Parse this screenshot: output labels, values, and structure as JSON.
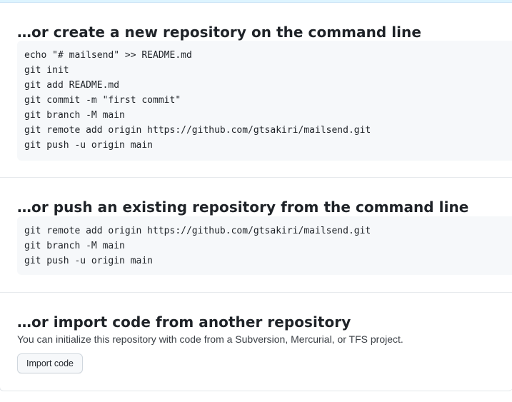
{
  "sections": {
    "new_repo": {
      "title": "…or create a new repository on the command line",
      "code_lines": [
        "echo \"# mailsend\" >> README.md",
        "git init",
        "git add README.md",
        "git commit -m \"first commit\"",
        "git branch -M main",
        "git remote add origin https://github.com/gtsakiri/mailsend.git",
        "git push -u origin main"
      ]
    },
    "push_existing": {
      "title": "…or push an existing repository from the command line",
      "code_lines": [
        "git remote add origin https://github.com/gtsakiri/mailsend.git",
        "git branch -M main",
        "git push -u origin main"
      ]
    },
    "import_code": {
      "title": "…or import code from another repository",
      "description": "You can initialize this repository with code from a Subversion, Mercurial, or TFS project.",
      "button_label": "Import code"
    }
  },
  "colors": {
    "code_background": "#f6f8fa",
    "border": "#d0d7de",
    "text": "#1f2328",
    "top_strip": "#ddf4ff"
  }
}
